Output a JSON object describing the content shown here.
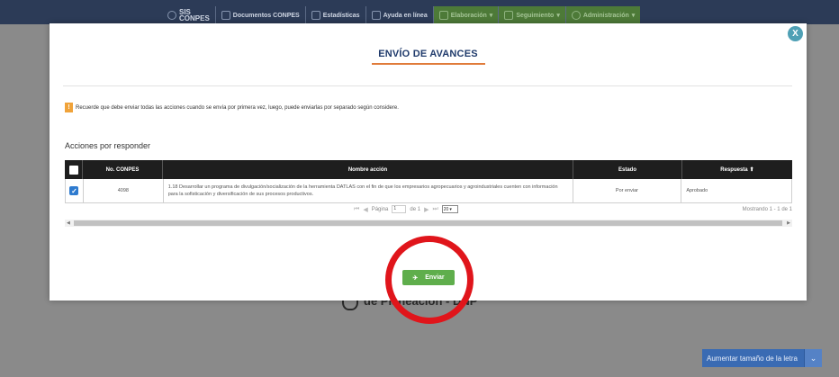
{
  "topnav": {
    "logo_line1": "SIS",
    "logo_line2": "CONPES",
    "items": [
      {
        "label": "Documentos CONPES",
        "icon": "document-icon"
      },
      {
        "label": "Estadísticas",
        "icon": "chart-icon"
      },
      {
        "label": "Ayuda en línea",
        "icon": "help-icon"
      },
      {
        "label": "Elaboración",
        "icon": "edit-icon",
        "dropdown": true,
        "accent": "#4d7a38"
      },
      {
        "label": "Seguimiento",
        "icon": "tracking-icon",
        "dropdown": true,
        "accent": "#4d7a38"
      },
      {
        "label": "Administración",
        "icon": "admin-icon",
        "dropdown": true,
        "accent": "#4d7a38"
      }
    ]
  },
  "background": {
    "footer_text": "de Planeación - DNP",
    "font_button": "Aumentar tamaño de la letra"
  },
  "modal": {
    "close_label": "X",
    "title": "ENVÍO DE AVANCES",
    "notice": "Recuerde que debe enviar todas las acciones cuando se envía por primera vez, luego, puede enviarlas por separado según considere.",
    "section_title": "Acciones por responder",
    "table": {
      "headers": {
        "conpes": "No. CONPES",
        "name": "Nombre acción",
        "estado": "Estado",
        "respuesta": "Respuesta"
      },
      "rows": [
        {
          "checked": true,
          "conpes": "4098",
          "name": "1.18 Desarrollar un programa de divulgación/socialización de la herramienta DATLAS con el fin de que los empresarios agropecuarios y agroindustriales cuenten con información para la sofisticación y diversificación de sus procesos productivos.",
          "estado": "Por enviar",
          "respuesta": "Aprobado"
        }
      ]
    },
    "pager": {
      "page_label": "Página",
      "page_value": "1",
      "of_label": "de 1",
      "page_size": "20",
      "summary": "Mostrando 1 - 1 de 1"
    },
    "send_button": "Enviar"
  },
  "colors": {
    "nav_bg": "#2c3b57",
    "title": "#1f3a6b",
    "title_underline": "#e07b3a",
    "send_button": "#5fae4c",
    "highlight_circle": "#e0151b",
    "close_button": "#4fa0b5",
    "checkbox": "#2e7bcf",
    "warning": "#f0a33a"
  }
}
